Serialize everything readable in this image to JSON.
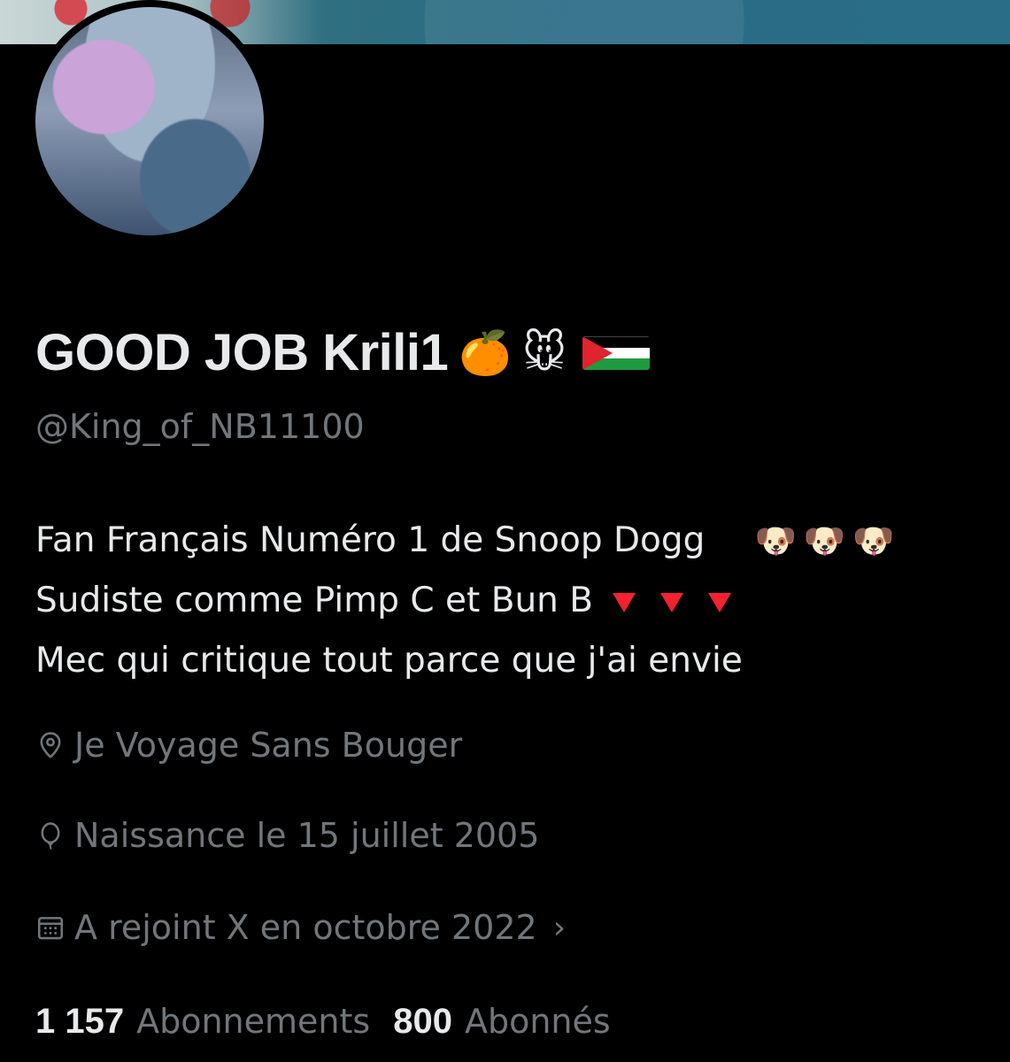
{
  "profile": {
    "display_name": "GOOD JOB Krili1",
    "name_emojis": [
      "🍊",
      "🐭"
    ],
    "flag_icon": "palestine-flag-icon",
    "handle": "@King_of_NB11100",
    "bio": {
      "line1": "Fan Français Numéro 1 de Snoop Dogg",
      "line1_emojis": [
        "🐶",
        "🐶",
        "🐶"
      ],
      "line2": "Sudiste comme Pimp C et Bun B",
      "line2_icons": [
        "red-triangle-down-icon",
        "red-triangle-down-icon",
        "red-triangle-down-icon"
      ],
      "line3": "Mec qui critique tout parce que j'ai envie"
    },
    "location": "Je Voyage Sans Bouger",
    "birth": "Naissance le 15 juillet 2005",
    "joined": "A rejoint X en octobre 2022",
    "following_count": "1 157",
    "following_label": "Abonnements",
    "followers_count": "800",
    "followers_label": "Abonnés"
  },
  "colors": {
    "background": "#000000",
    "primary_text": "#e7e9ea",
    "secondary_text": "#71767b",
    "accent_red": "#f4212e"
  }
}
